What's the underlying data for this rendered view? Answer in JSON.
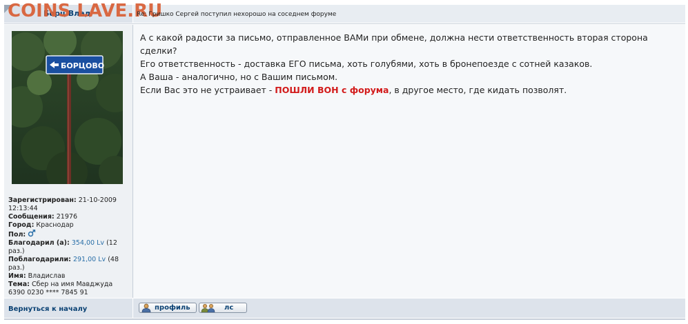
{
  "watermark": "COINS LAVE.RU",
  "post": {
    "author": "Борц Влад",
    "subject": "Re: Гришко Сергей поступил нехорошо на соседнем форуме",
    "avatar_sign_text": "БОРЦОВО",
    "user_info": {
      "registered_label": "Зарегистрирован:",
      "registered_value": "21-10-2009 12:13:44",
      "messages_label": "Сообщения:",
      "messages_value": "21976",
      "city_label": "Город:",
      "city_value": "Краснодар",
      "gender_label": "Пол:",
      "thanked_label": "Благодарил (а):",
      "thanked_value": "354,00 Lv",
      "thanked_times": "(12 раз.)",
      "received_label": "Поблагодарили:",
      "received_value": "291,00 Lv",
      "received_times": "(48 раз.)",
      "name_label": "Имя:",
      "name_value": "Владислав",
      "topic_label": "Тема:",
      "topic_value": "Сбер на имя Мавджуда 6390 0230 **** 7845 91"
    },
    "message": {
      "line1": "А с какой радости за письмо, отправленное ВАМи при обмене, должна нести ответственность вторая сторона сделки?",
      "line2": "Его ответственность - доставка ЕГО письма, хоть голубями, хоть в бронепоезде с сотней казаков.",
      "line3": "А Ваша - аналогично, но с Вашим письмом.",
      "line4_before": "Если Вас это не устраивает - ",
      "line4_red": "ПОШЛИ ВОН с форума",
      "line4_after": ", в другое место, где кидать позволят."
    }
  },
  "footer": {
    "back_link": "Вернуться к началу",
    "profile_button": "профиль",
    "pm_button": "лс"
  },
  "colors": {
    "link": "#0a4173",
    "watermark": "#d9623a",
    "highlight_red": "#d21a1a",
    "lv_link": "#2a6fa8"
  }
}
